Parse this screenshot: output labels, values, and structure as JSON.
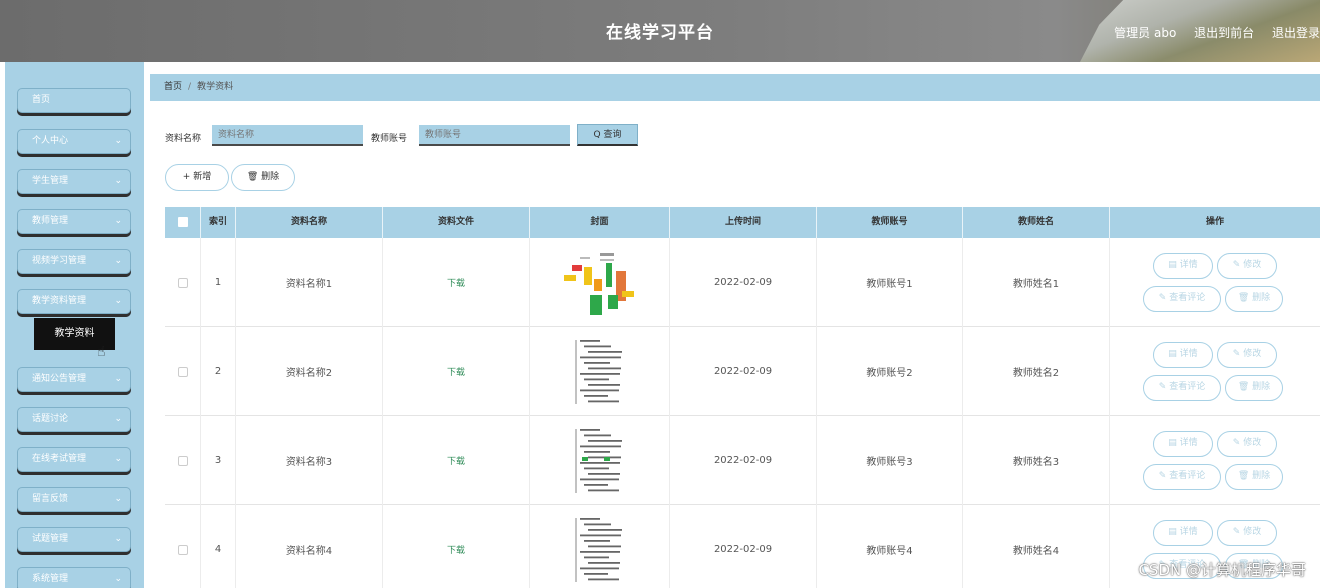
{
  "header": {
    "title": "在线学习平台",
    "admin": "管理员 abo",
    "to_front": "退出到前台",
    "logout": "退出登录"
  },
  "sidebar": {
    "items": [
      {
        "label": "首页",
        "chevron": false
      },
      {
        "label": "个人中心",
        "chevron": true
      },
      {
        "label": "学生管理",
        "chevron": true
      },
      {
        "label": "教师管理",
        "chevron": true
      },
      {
        "label": "视频学习管理",
        "chevron": true
      },
      {
        "label": "教学资料管理",
        "chevron": true
      },
      {
        "label": "通知公告管理",
        "chevron": true
      },
      {
        "label": "话题讨论",
        "chevron": true
      },
      {
        "label": "在线考试管理",
        "chevron": true
      },
      {
        "label": "留言反馈",
        "chevron": true
      },
      {
        "label": "试题管理",
        "chevron": true
      },
      {
        "label": "系统管理",
        "chevron": true
      }
    ],
    "submenu": "教学资料",
    "chevron_glyph": "⌄"
  },
  "breadcrumb": {
    "home": "首页",
    "sep": "/",
    "current": "教学资料"
  },
  "search": {
    "name_label": "资料名称",
    "name_placeholder": "资料名称",
    "teacher_label": "教师账号",
    "teacher_placeholder": "教师账号",
    "query_button": "Q 查询"
  },
  "actions": {
    "add": "+ 新增",
    "delete": "🗑 删除"
  },
  "table": {
    "headers": [
      "",
      "索引",
      "资料名称",
      "资料文件",
      "封面",
      "上传时间",
      "教师账号",
      "教师姓名",
      "操作"
    ],
    "rows": [
      {
        "index": "1",
        "name": "资料名称1",
        "file": "下载",
        "time": "2022-02-09",
        "account": "教师账号1",
        "teacher": "教师姓名1"
      },
      {
        "index": "2",
        "name": "资料名称2",
        "file": "下载",
        "time": "2022-02-09",
        "account": "教师账号2",
        "teacher": "教师姓名2"
      },
      {
        "index": "3",
        "name": "资料名称3",
        "file": "下载",
        "time": "2022-02-09",
        "account": "教师账号3",
        "teacher": "教师姓名3"
      },
      {
        "index": "4",
        "name": "资料名称4",
        "file": "下载",
        "time": "2022-02-09",
        "account": "教师账号4",
        "teacher": "教师姓名4"
      }
    ],
    "ops": {
      "detail": "详情",
      "edit": "修改",
      "comments": "查看评论",
      "delete": "删除"
    }
  },
  "watermark": "CSDN @计算机程序华哥",
  "colors": {
    "accent": "#a8d1e5",
    "download": "#2e8b57",
    "header": "#7a7a7a"
  }
}
